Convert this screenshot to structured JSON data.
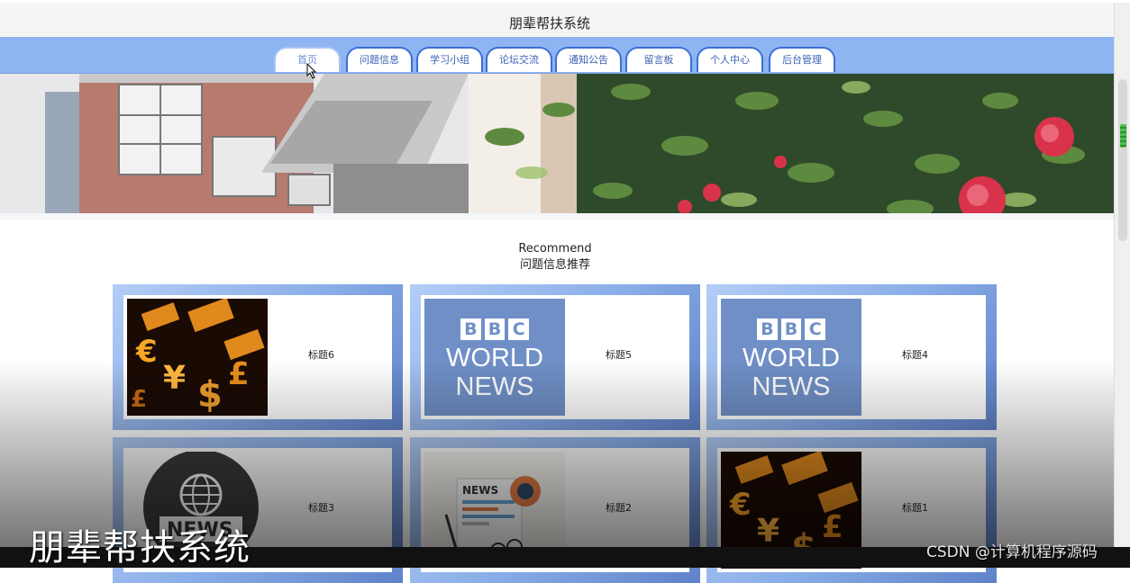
{
  "header": {
    "site_title": "朋辈帮扶系统"
  },
  "nav": {
    "tabs": [
      {
        "label": "首页",
        "active": true
      },
      {
        "label": "问题信息"
      },
      {
        "label": "学习小组"
      },
      {
        "label": "论坛交流"
      },
      {
        "label": "通知公告"
      },
      {
        "label": "留言板"
      },
      {
        "label": "个人中心"
      },
      {
        "label": "后台管理"
      }
    ]
  },
  "section": {
    "title_en": "Recommend",
    "title_cn": "问题信息推荐"
  },
  "cards": [
    {
      "title": "标题6",
      "image": "currency-image"
    },
    {
      "title": "标题5",
      "image": "bbc-world-news-image",
      "logo_line1": "BBC",
      "logo_line2": "WORLD",
      "logo_line3": "NEWS"
    },
    {
      "title": "标题4",
      "image": "bbc-world-news-image",
      "logo_line1": "BBC",
      "logo_line2": "WORLD",
      "logo_line3": "NEWS"
    },
    {
      "title": "标题3",
      "image": "news-globe-image",
      "logo_text": "NEWS"
    },
    {
      "title": "标题2",
      "image": "newspaper-image",
      "logo_text": "NEWS"
    },
    {
      "title": "标题1",
      "image": "currency-image"
    }
  ],
  "overlay": {
    "caption": "朋辈帮扶系统",
    "watermark": "CSDN @计算机程序源码"
  },
  "colors": {
    "nav_bg": "#8fb4f2",
    "tab_border": "#3b6fd6",
    "card_frame": "#8aaee8",
    "bbc_blue": "#6f8fc6"
  }
}
